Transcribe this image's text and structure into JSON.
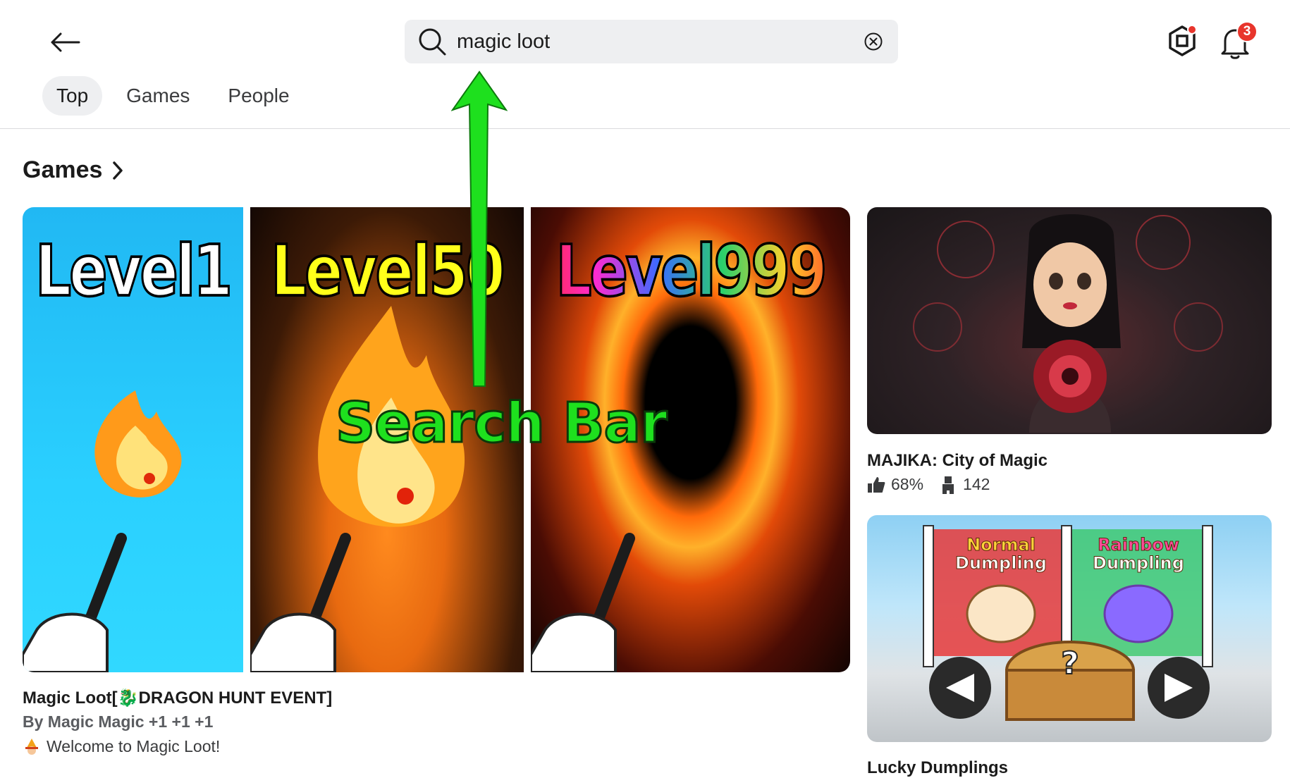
{
  "header": {
    "search_value": "magic loot",
    "notification_count": "3"
  },
  "tabs": [
    {
      "label": "Top",
      "active": true
    },
    {
      "label": "Games",
      "active": false
    },
    {
      "label": "People",
      "active": false
    }
  ],
  "section": {
    "title": "Games"
  },
  "featured_game": {
    "thumbnail_texts": [
      "Level1",
      "Level50",
      "Level999"
    ],
    "title": "Magic Loot[🐉DRAGON HUNT EVENT]",
    "creator": "By Magic Magic +1 +1 +1",
    "description": "Welcome to Magic Loot!"
  },
  "side_games": [
    {
      "title": "MAJIKA: City of Magic",
      "rating": "68%",
      "players": "142"
    },
    {
      "title": "Lucky Dumplings",
      "thumbnail_texts": [
        "Normal",
        "Dumpling",
        "Rainbow",
        "Dumpling"
      ]
    }
  ],
  "annotation": {
    "label": "Search Bar",
    "color": "#1ee01e"
  }
}
